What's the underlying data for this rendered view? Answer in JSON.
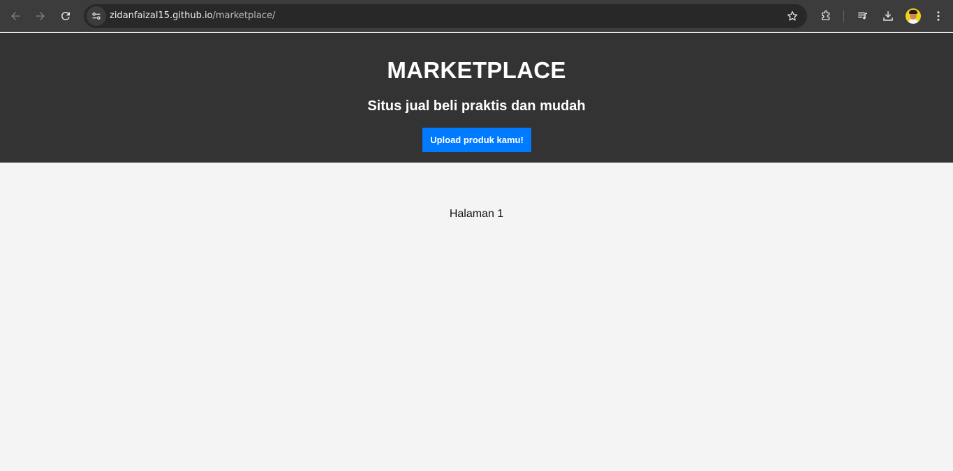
{
  "browser": {
    "url_host": "zidanfaizal15.github.io",
    "url_path": "/marketplace/",
    "icons": [
      "back-icon",
      "forward-icon",
      "reload-icon",
      "site-info-icon",
      "bookmark-star-icon",
      "extensions-icon",
      "media-queue-icon",
      "download-icon",
      "profile-avatar",
      "menu-icon"
    ],
    "theme_color": "#3c3c3c"
  },
  "header": {
    "title": "MARKETPLACE",
    "subtitle": "Situs jual beli praktis dan mudah",
    "upload_label": "Upload produk kamu!",
    "background": "#333333",
    "button_color": "#007bff"
  },
  "main": {
    "page_label": "Halaman 1"
  }
}
